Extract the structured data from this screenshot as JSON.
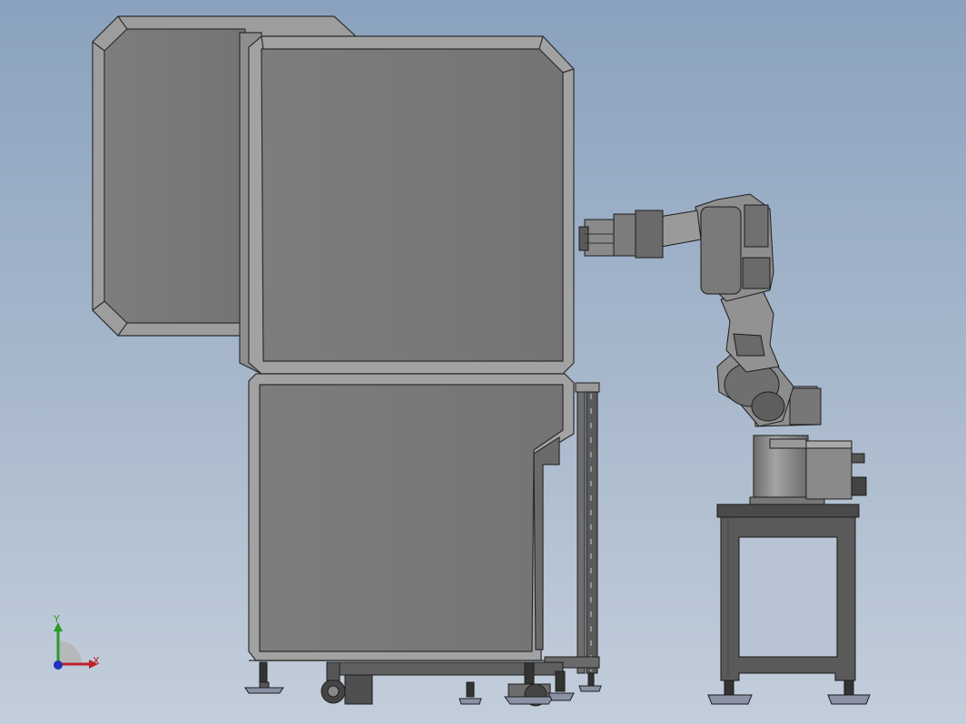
{
  "viewport": {
    "background_top": "#8aa2bf",
    "background_bottom": "#c3cedb"
  },
  "model": {
    "body_color": "#7a7a7a",
    "bevel_color": "#9a9a9a",
    "edge_color": "#2e2e2e",
    "robot_color": "#8a8a8a",
    "stand_color": "#5a5a5a"
  },
  "triad": {
    "x_label": "X",
    "y_label": "Y",
    "x_color": "#c0202a",
    "y_color": "#2a9a2a",
    "z_color": "#2030c0"
  }
}
